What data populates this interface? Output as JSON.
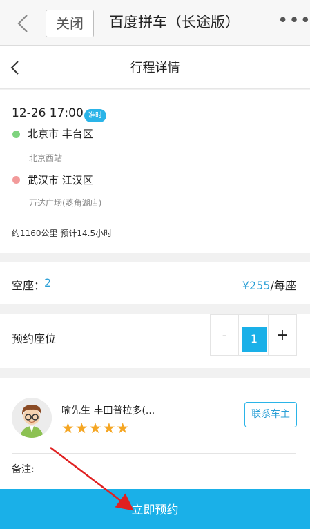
{
  "topbar": {
    "close_label": "关闭",
    "title": "百度拼车（长途版）",
    "more_label": "•••"
  },
  "subbar": {
    "title": "行程详情"
  },
  "trip": {
    "datetime": "12-26 17:00",
    "badge": "准时",
    "origin_city": "北京市 丰台区",
    "origin_spot": "北京西站",
    "dest_city": "武汉市 江汉区",
    "dest_spot": "万达广场(菱角湖店)",
    "distance": "约1160公里 预计14.5小时"
  },
  "seats": {
    "label": "空座：",
    "count": "2",
    "price": "¥255",
    "unit": "/每座"
  },
  "booking": {
    "label": "预约座位",
    "minus": "-",
    "value": "1",
    "plus": "+"
  },
  "driver": {
    "name": "喻先生 丰田普拉多(...",
    "rating": 5,
    "stars": "★★★★★",
    "contact_label": "联系车主",
    "note_label": "备注:"
  },
  "footer": {
    "reserve_label": "立即预约"
  },
  "colors": {
    "accent": "#1ab0e8",
    "star": "#f5a623",
    "annotation_arrow": "#e02020"
  }
}
